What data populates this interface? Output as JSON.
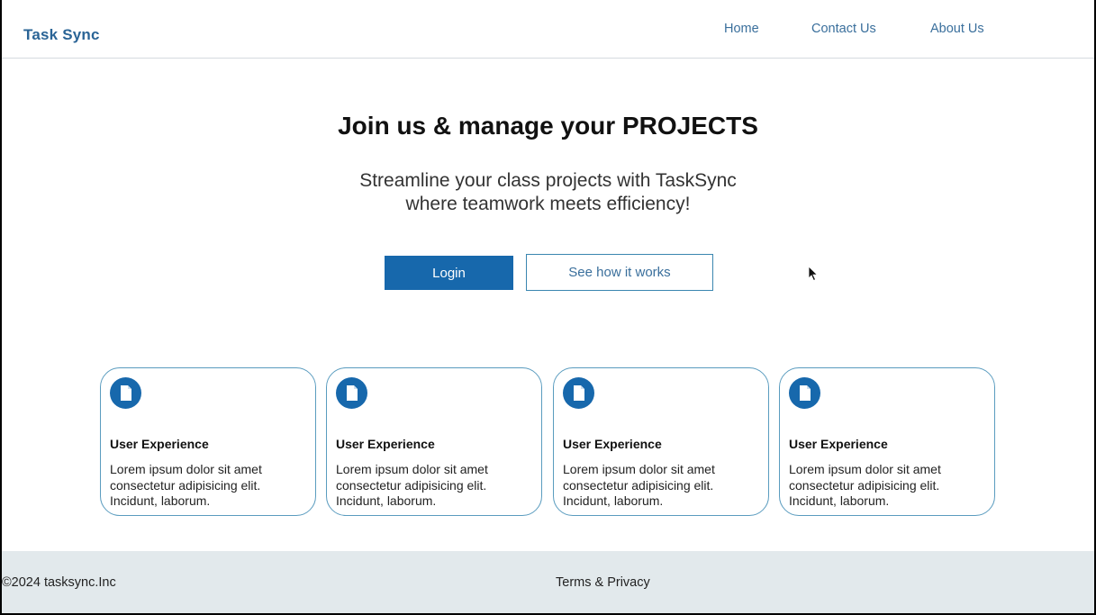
{
  "header": {
    "brand": "Task Sync",
    "nav": {
      "home": "Home",
      "contact": "Contact Us",
      "about": "About Us"
    }
  },
  "hero": {
    "title": "Join us & manage your PROJECTS",
    "subtitle_line1": "Streamline your class projects with TaskSync",
    "subtitle_line2": "where teamwork meets efficiency!",
    "login_label": "Login",
    "how_label": "See how it works"
  },
  "cards": [
    {
      "icon": "document-icon",
      "title": "User Experience",
      "body": "Lorem ipsum dolor sit amet consectetur adipisicing elit. Incidunt, laborum."
    },
    {
      "icon": "document-icon",
      "title": "User Experience",
      "body": "Lorem ipsum dolor sit amet consectetur adipisicing elit. Incidunt, laborum."
    },
    {
      "icon": "document-icon",
      "title": "User Experience",
      "body": "Lorem ipsum dolor sit amet consectetur adipisicing elit. Incidunt, laborum."
    },
    {
      "icon": "document-icon",
      "title": "User Experience",
      "body": "Lorem ipsum dolor sit amet consectetur adipisicing elit. Incidunt, laborum."
    }
  ],
  "footer": {
    "copyright": "©2024 tasksync.Inc",
    "terms": "Terms & Privacy"
  },
  "colors": {
    "brand": "#2a6496",
    "primary_button": "#1768ac",
    "card_border": "#5a9cbf",
    "footer_bg": "#e2e9ec"
  }
}
